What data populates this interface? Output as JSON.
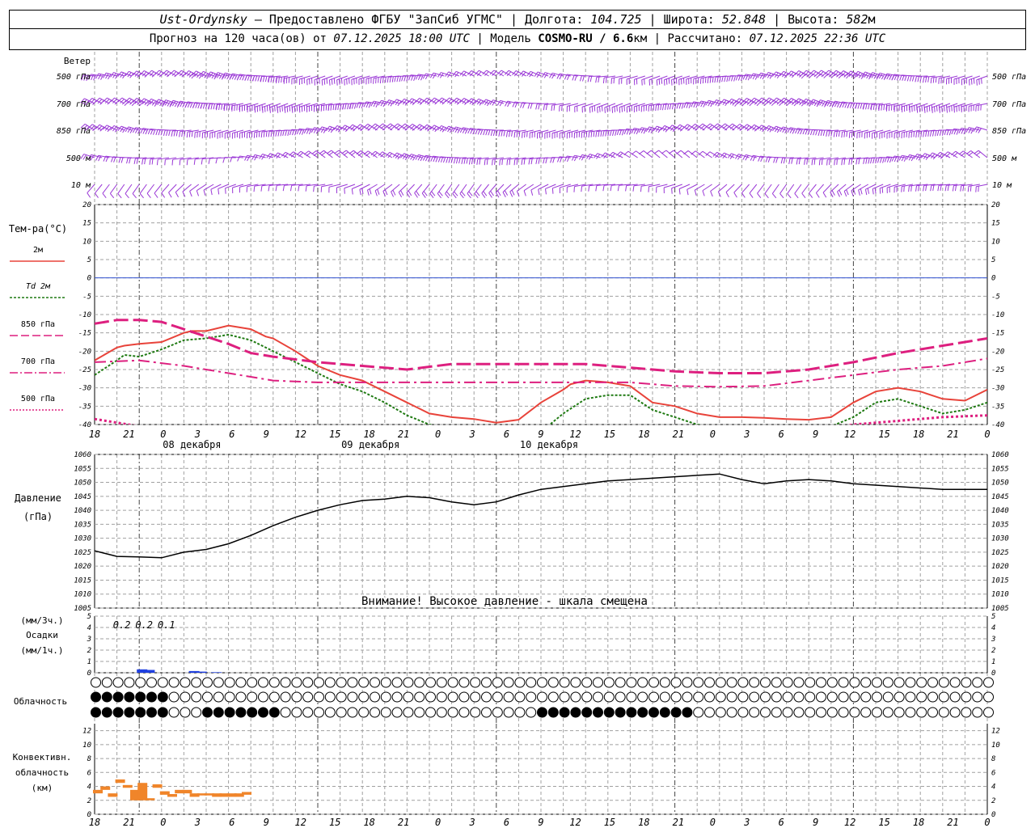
{
  "header": {
    "station": "Ust-Ordynsky",
    "provider": " — Предоставлено ФГБУ \"ЗапСиб УГМС\" | ",
    "lon_label": "Долгота: ",
    "lon": "104.725",
    "lat_label": " | Широта: ",
    "lat": "52.848",
    "alt_label": " | Высота: ",
    "alt": "582",
    "alt_unit": "м",
    "forecast_label": "Прогноз на 120 часа(ов) от ",
    "forecast_start": "07.12.2025 18:00 UTC",
    "model_label": " | Модель ",
    "model": "COSMO-RU / 6.6",
    "model_unit": "км",
    "calc_label": " | Рассчитано: ",
    "calc_time": "07.12.2025 22:36 UTC"
  },
  "colors": {
    "wind": "#9a37d6",
    "t2m": "#e8433a",
    "td2m": "#1f7a12",
    "t850": "#dd1f7f",
    "t700": "#dd1f7f",
    "t500": "#dd1f7f",
    "zero_line": "#3050d0",
    "precip": "#2040e0",
    "conv": "#f0852a",
    "grid": "#a0a0a0"
  },
  "wind_panel": {
    "title": "Ветер",
    "levels": [
      "500 гПа",
      "700 гПа",
      "850 гПа",
      "500 м",
      "10 м"
    ]
  },
  "temp_panel": {
    "title": "Тем-ра(°C)",
    "legend": [
      {
        "label": "2м"
      },
      {
        "label": "Td 2м"
      },
      {
        "label": "850 гПа"
      },
      {
        "label": "700 гПа"
      },
      {
        "label": "500 гПа"
      }
    ],
    "yticks": [
      "20",
      "15",
      "10",
      "5",
      "0",
      "-5",
      "-10",
      "-15",
      "-20",
      "-25",
      "-30",
      "-35",
      "-40"
    ]
  },
  "pressure_panel": {
    "title": "Давление",
    "unit": "(гПа)",
    "warning": "Внимание! Высокое давление - шкала смещена",
    "yticks": [
      "1060",
      "1055",
      "1050",
      "1045",
      "1040",
      "1035",
      "1030",
      "1025",
      "1020",
      "1015",
      "1010",
      "1005"
    ]
  },
  "precip_panel": {
    "unit3": "(мм/3ч.)",
    "title": "Осадки",
    "unit1": "(мм/1ч.)",
    "yticks": [
      "5",
      "4",
      "3",
      "2",
      "1",
      "0"
    ],
    "labels": [
      {
        "hour": 3,
        "text": "0.2"
      },
      {
        "hour": 6,
        "text": "0.2"
      },
      {
        "hour": 9,
        "text": "0.1"
      }
    ]
  },
  "cloud_panel": {
    "title": "Облачность"
  },
  "conv_panel": {
    "title1": "Конвективн.",
    "title2": "облачность",
    "unit": "(км)",
    "yticks": [
      "12",
      "10",
      "8",
      "6",
      "4",
      "2",
      "0"
    ]
  },
  "time_axis": {
    "hour_labels": [
      "18",
      "21",
      "0",
      "3",
      "6",
      "9",
      "12",
      "15",
      "18",
      "21",
      "0",
      "3",
      "6",
      "9",
      "12",
      "15",
      "18",
      "21",
      "0",
      "3",
      "6",
      "9",
      "12",
      "15",
      "18",
      "21",
      "0"
    ],
    "day_labels": [
      {
        "text": "08 декабря",
        "hour": 12
      },
      {
        "text": "09 декабря",
        "hour": 36
      },
      {
        "text": "10 декабря",
        "hour": 60
      }
    ]
  },
  "chart_data": [
    {
      "type": "line",
      "title": "Тем-ра(°C)",
      "xlabel": "",
      "ylabel": "",
      "ylim": [
        -40,
        20
      ],
      "x_unit": "hours from 07.12.2025 18:00 UTC",
      "grid": true,
      "series": [
        {
          "name": "2м",
          "x": [
            0,
            3,
            4,
            6,
            9,
            12,
            13,
            15,
            18,
            21,
            23,
            24,
            27,
            30,
            33,
            36,
            38,
            39,
            42,
            45,
            48,
            51,
            54,
            57,
            60,
            63,
            64,
            66,
            68,
            69,
            72,
            75,
            78,
            81,
            84,
            87,
            90,
            93,
            96,
            99,
            102,
            105,
            108,
            111,
            114,
            117,
            120
          ],
          "y": [
            -22.5,
            -19,
            -18.5,
            -18,
            -17.5,
            -15,
            -14.5,
            -14.5,
            -13,
            -14,
            -16,
            -16.5,
            -20,
            -24,
            -26.5,
            -28,
            -30,
            -31,
            -34,
            -37,
            -38,
            -38.5,
            -39.5,
            -38.7,
            -34,
            -30.5,
            -29,
            -28,
            -28.3,
            -28.5,
            -29.5,
            -34,
            -35,
            -37,
            -38,
            -38,
            -38.2,
            -38.5,
            -38.7,
            -38,
            -34,
            -31,
            -30,
            -31,
            -33,
            -33.5,
            -30.5
          ]
        },
        {
          "name": "Td 2м",
          "x": [
            0,
            3,
            4,
            6,
            9,
            12,
            15,
            18,
            21,
            24,
            27,
            30,
            33,
            36,
            39,
            42,
            45,
            48,
            51,
            54,
            57,
            60,
            63,
            66,
            69,
            72,
            75,
            78,
            81,
            84,
            87,
            90,
            93,
            96,
            99,
            102,
            105,
            108,
            111,
            114,
            117,
            120
          ],
          "y": [
            -26.5,
            -22.5,
            -21,
            -21.5,
            -19.5,
            -17,
            -16.5,
            -15.5,
            -17,
            -20,
            -23,
            -26,
            -29,
            -31,
            -34,
            -37.5,
            -40,
            -41,
            -42,
            -42,
            -41.5,
            -42,
            -37,
            -33,
            -32,
            -32,
            -36,
            -38,
            -40,
            -41,
            -41,
            -41.5,
            -42,
            -42,
            -40.5,
            -38,
            -34,
            -33,
            -35,
            -37,
            -36,
            -34
          ]
        },
        {
          "name": "850 гПа",
          "x": [
            0,
            3,
            6,
            9,
            12,
            15,
            18,
            21,
            24,
            30,
            36,
            42,
            48,
            54,
            60,
            66,
            72,
            78,
            84,
            90,
            96,
            102,
            108,
            114,
            120
          ],
          "y": [
            -12.5,
            -11.5,
            -11.5,
            -12,
            -14,
            -16,
            -18,
            -20.5,
            -21.5,
            -23,
            -24,
            -25,
            -23.5,
            -23.5,
            -23.5,
            -23.5,
            -24.5,
            -25.5,
            -26,
            -26,
            -25,
            -23,
            -20.5,
            -18.5,
            -16.5
          ]
        },
        {
          "name": "700 гПа",
          "x": [
            0,
            6,
            12,
            18,
            24,
            30,
            36,
            42,
            48,
            54,
            60,
            66,
            72,
            78,
            84,
            90,
            96,
            102,
            108,
            114,
            120
          ],
          "y": [
            -23,
            -22.5,
            -24,
            -26,
            -28,
            -28.5,
            -28.5,
            -28.5,
            -28.5,
            -28.5,
            -28.5,
            -28.5,
            -28.5,
            -29.5,
            -29.7,
            -29.5,
            -28,
            -26.5,
            -25,
            -24,
            -22
          ]
        },
        {
          "name": "500 гПа",
          "x": [
            0,
            3,
            6,
            9,
            12,
            15,
            18,
            21,
            24,
            30,
            36,
            42,
            48,
            54,
            60,
            66,
            72,
            78,
            84,
            90,
            96,
            102,
            108,
            114,
            120
          ],
          "y": [
            -38.5,
            -39.5,
            -40.5,
            -41.5,
            -43,
            -45,
            -46,
            -48,
            -48,
            -48,
            -48,
            -49,
            -48,
            -46,
            -47,
            -45,
            -44,
            -44,
            -43,
            -43,
            -42,
            -40,
            -39,
            -38,
            -37.5
          ]
        }
      ]
    },
    {
      "type": "line",
      "title": "Давление",
      "ylabel": "(гПа)",
      "ylim": [
        1005,
        1060
      ],
      "x_unit": "hours from 07.12.2025 18:00 UTC",
      "grid": true,
      "series": [
        {
          "name": "",
          "x": [
            0,
            3,
            6,
            9,
            12,
            15,
            18,
            21,
            24,
            27,
            30,
            33,
            36,
            39,
            42,
            45,
            48,
            51,
            54,
            57,
            60,
            63,
            66,
            69,
            72,
            75,
            78,
            81,
            84,
            87,
            90,
            93,
            96,
            99,
            102,
            105,
            108,
            111,
            114,
            117,
            120
          ],
          "y": [
            1025.5,
            1023.5,
            1023.3,
            1023,
            1025,
            1026,
            1028,
            1031,
            1034.5,
            1037.5,
            1040,
            1042,
            1043.5,
            1044,
            1045,
            1044.5,
            1043,
            1042,
            1043,
            1045.5,
            1047.5,
            1048.5,
            1049.5,
            1050.5,
            1051,
            1051.5,
            1052,
            1052.5,
            1053,
            1051,
            1049.5,
            1050.5,
            1051,
            1050.5,
            1049.5,
            1049,
            1048.5,
            1048,
            1047.5,
            1047.5,
            1047.5
          ]
        }
      ]
    },
    {
      "type": "bar",
      "title": "Осадки",
      "ylabel": "(мм/3ч.) (мм/1ч.)",
      "ylim": [
        0,
        5
      ],
      "x_unit": "hours from 07.12.2025 18:00 UTC",
      "grid": true,
      "series": [
        {
          "name": "",
          "x": [
            6,
            7,
            13,
            14,
            16
          ],
          "y": [
            0.3,
            0.25,
            0.15,
            0.1,
            0.05
          ]
        }
      ]
    },
    {
      "type": "bar",
      "title": "Конвективн. облачность",
      "ylabel": "(км)",
      "ylim": [
        0,
        13
      ],
      "x_unit": "hours from 07.12.2025 18:00 UTC",
      "grid": true,
      "series": [
        {
          "name": "",
          "x": [
            0,
            1,
            2,
            3,
            4,
            5,
            6,
            7,
            8,
            9,
            10,
            11,
            12,
            13,
            14,
            15,
            16,
            17,
            18,
            19,
            20
          ],
          "bottom": [
            3,
            3.5,
            2.5,
            4.5,
            3.8,
            2,
            2,
            2,
            3.8,
            2.8,
            2.5,
            3,
            3,
            2.5,
            2.7,
            2.7,
            2.5,
            2.5,
            2.5,
            2.5,
            2.8
          ],
          "top": [
            3.5,
            4,
            3,
            5,
            4.2,
            3.5,
            4.5,
            2.3,
            4.3,
            3.3,
            2.9,
            3.5,
            3.5,
            3,
            3,
            3,
            3,
            3,
            3,
            3,
            3.2
          ]
        }
      ]
    }
  ]
}
